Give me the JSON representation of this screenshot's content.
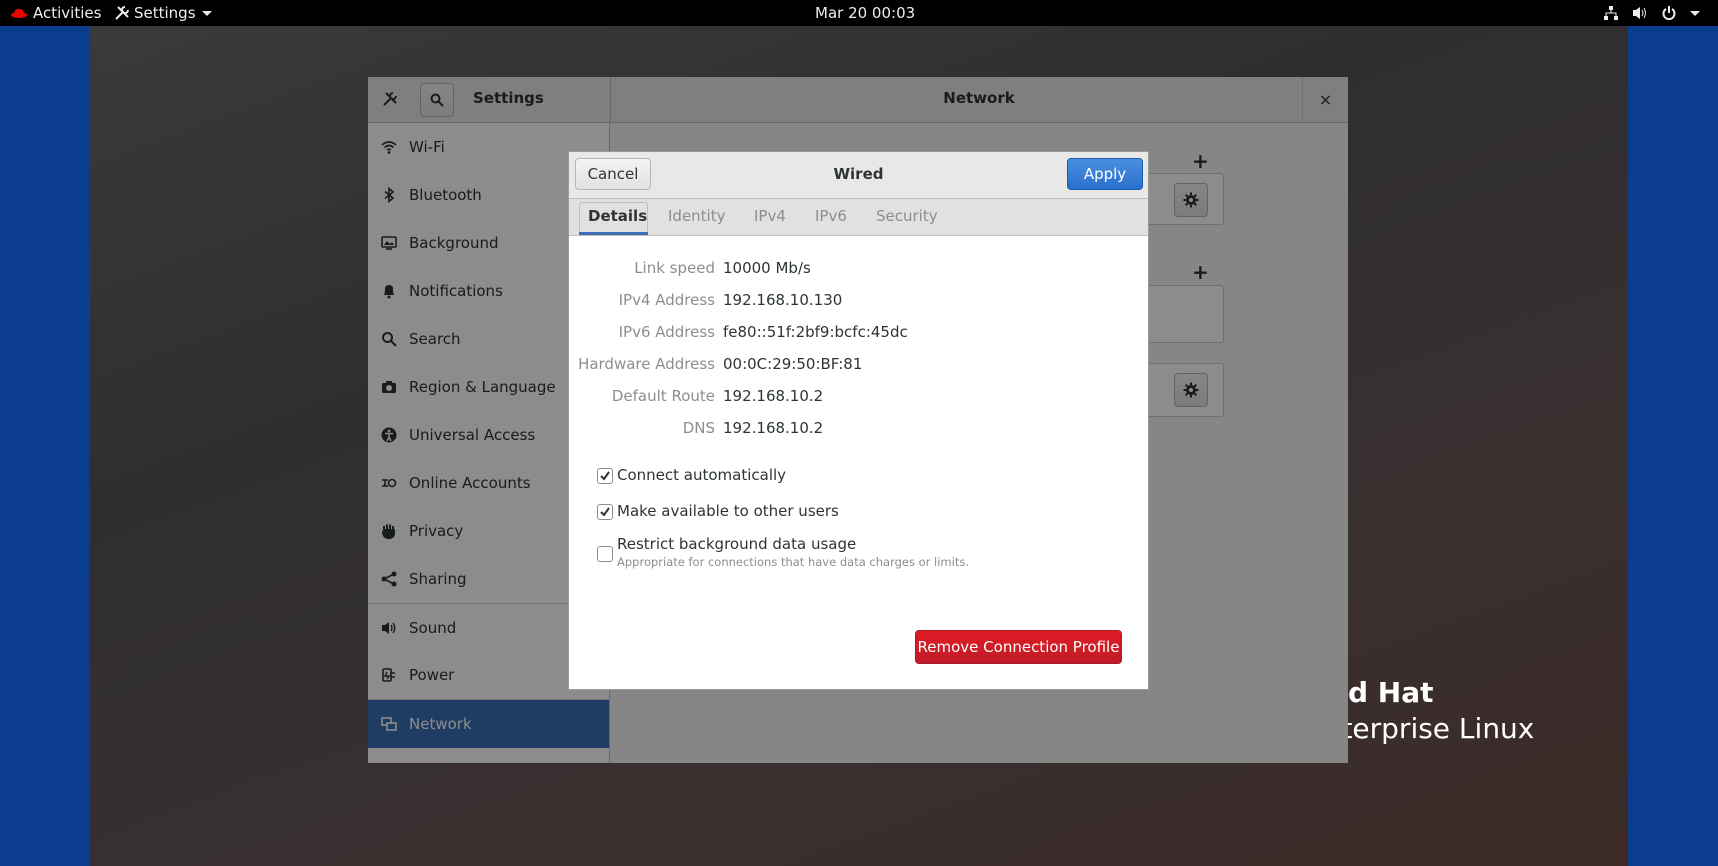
{
  "topbar": {
    "activities": "Activities",
    "app_menu": "Settings",
    "clock": "Mar 20  00:03"
  },
  "settings_window": {
    "sidebar_title": "Settings",
    "main_title": "Network",
    "close_glyph": "×",
    "sidebar_items": [
      {
        "label": "Wi-Fi",
        "icon": "wifi-icon"
      },
      {
        "label": "Bluetooth",
        "icon": "bluetooth-icon"
      },
      {
        "label": "Background",
        "icon": "background-icon"
      },
      {
        "label": "Notifications",
        "icon": "bell-icon"
      },
      {
        "label": "Search",
        "icon": "search-icon"
      },
      {
        "label": "Region & Language",
        "icon": "camera-icon"
      },
      {
        "label": "Universal Access",
        "icon": "accessibility-icon"
      },
      {
        "label": "Online Accounts",
        "icon": "online-accounts-icon"
      },
      {
        "label": "Privacy",
        "icon": "hand-icon"
      },
      {
        "label": "Sharing",
        "icon": "share-icon"
      },
      {
        "label": "Sound",
        "icon": "speaker-icon"
      },
      {
        "label": "Power",
        "icon": "power-plug-icon"
      },
      {
        "label": "Network",
        "icon": "network-icon"
      }
    ],
    "selected_item": "Network",
    "add_glyph": "+"
  },
  "dialog": {
    "title": "Wired",
    "cancel_label": "Cancel",
    "apply_label": "Apply",
    "tabs": [
      "Details",
      "Identity",
      "IPv4",
      "IPv6",
      "Security"
    ],
    "active_tab": "Details",
    "details": [
      {
        "key": "Link speed",
        "value": "10000 Mb/s"
      },
      {
        "key": "IPv4 Address",
        "value": "192.168.10.130"
      },
      {
        "key": "IPv6 Address",
        "value": "fe80::51f:2bf9:bcfc:45dc"
      },
      {
        "key": "Hardware Address",
        "value": "00:0C:29:50:BF:81"
      },
      {
        "key": "Default Route",
        "value": "192.168.10.2"
      },
      {
        "key": "DNS",
        "value": "192.168.10.2"
      }
    ],
    "options": [
      {
        "label": "Connect automatically",
        "checked": true
      },
      {
        "label": "Make available to other users",
        "checked": true
      },
      {
        "label": "Restrict background data usage",
        "sublabel": "Appropriate for connections that have data charges or limits.",
        "checked": false
      }
    ],
    "remove_label": "Remove Connection Profile"
  },
  "branding": {
    "line1": "d Hat",
    "line2": "Enterprise Linux"
  },
  "colors": {
    "accent": "#3a6db4",
    "apply": "#2a6fcc",
    "destructive": "#e01b24",
    "desktop_edge": "#0b3d8f"
  }
}
